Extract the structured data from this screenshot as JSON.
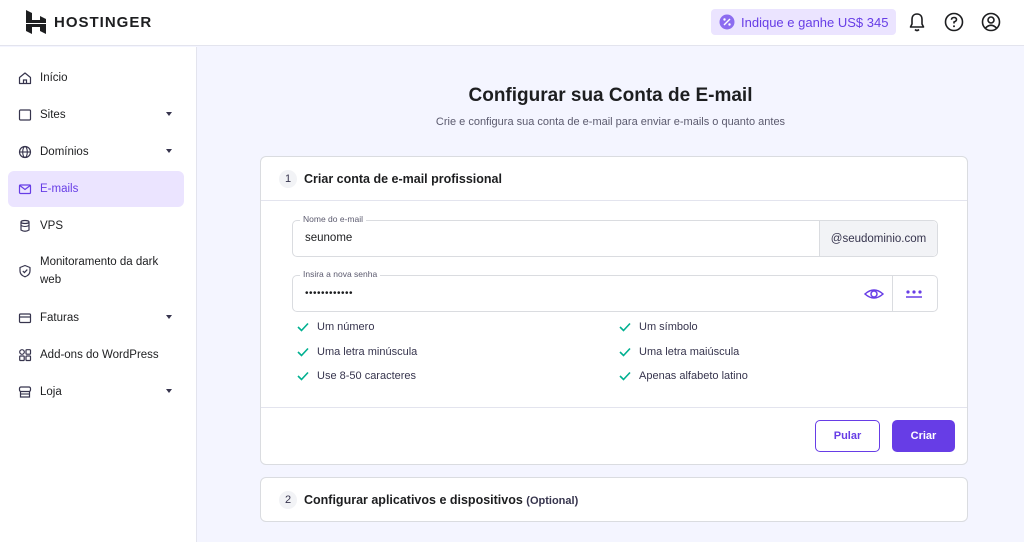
{
  "brand": {
    "name": "HOSTINGER"
  },
  "topbar": {
    "refer_label": "Indique e ganhe US$ 345",
    "icons": [
      "bell-icon",
      "help-icon",
      "account-icon"
    ]
  },
  "sidebar": {
    "items": [
      {
        "label": "Início",
        "icon": "home-icon",
        "has_chevron": false,
        "active": false
      },
      {
        "label": "Sites",
        "icon": "window-icon",
        "has_chevron": true,
        "active": false
      },
      {
        "label": "Domínios",
        "icon": "globe-icon",
        "has_chevron": true,
        "active": false
      },
      {
        "label": "E-mails",
        "icon": "mail-icon",
        "has_chevron": false,
        "active": true
      },
      {
        "label": "VPS",
        "icon": "server-icon",
        "has_chevron": false,
        "active": false
      },
      {
        "label": "Monitoramento da dark web",
        "icon": "shield-icon",
        "has_chevron": false,
        "active": false
      },
      {
        "label": "Faturas",
        "icon": "card-icon",
        "has_chevron": true,
        "active": false
      },
      {
        "label": "Add-ons do WordPress",
        "icon": "addons-icon",
        "has_chevron": false,
        "active": false
      },
      {
        "label": "Loja",
        "icon": "store-icon",
        "has_chevron": true,
        "active": false
      }
    ]
  },
  "main": {
    "title": "Configurar sua Conta de E-mail",
    "subtitle": "Crie e configura sua conta de e-mail para enviar e-mails o quanto antes",
    "step1": {
      "number": "1",
      "title": "Criar conta de e-mail profissional",
      "email_field": {
        "label": "Nome do e-mail",
        "value": "seunome",
        "suffix": "@seudominio.com"
      },
      "password_field": {
        "label": "Insira a nova senha",
        "value": "••••••••••••"
      },
      "requirements_left": [
        "Um número",
        "Uma letra minúscula",
        "Use 8-50 caracteres"
      ],
      "requirements_right": [
        "Um símbolo",
        "Uma letra maiúscula",
        "Apenas alfabeto latino"
      ],
      "skip_label": "Pular",
      "create_label": "Criar"
    },
    "step2": {
      "number": "2",
      "title": "Configurar aplicativos e dispositivos",
      "optional": "(Optional)"
    }
  },
  "colors": {
    "accent": "#673de6",
    "accent_soft": "#ebe4ff",
    "check": "#00b090",
    "background": "#f4f5ff"
  }
}
